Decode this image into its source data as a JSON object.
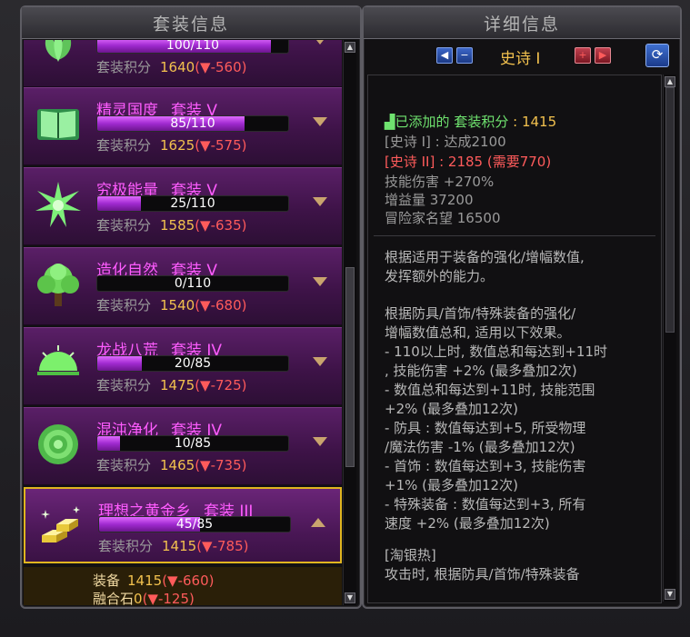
{
  "left_panel": {
    "title": "套装信息",
    "items": [
      {
        "name": "",
        "tier": "",
        "progress_text": "100/110",
        "progress": 0.909,
        "score_label": "套装积分",
        "score": "1640",
        "delta": "(▼-560)",
        "icon": "leaf-icon",
        "expanded": false
      },
      {
        "name": "精灵国度",
        "tier_prefix": "套装",
        "tier": "V",
        "progress_text": "85/110",
        "progress": 0.773,
        "score_label": "套装积分",
        "score": "1625",
        "delta": "(▼-575)",
        "icon": "book-icon",
        "expanded": false
      },
      {
        "name": "究极能量",
        "tier_prefix": "套装",
        "tier": "V",
        "progress_text": "25/110",
        "progress": 0.227,
        "score_label": "套装积分",
        "score": "1585",
        "delta": "(▼-635)",
        "icon": "starburst-icon",
        "expanded": false
      },
      {
        "name": "造化自然",
        "tier_prefix": "套装",
        "tier": "V",
        "progress_text": "0/110",
        "progress": 0.0,
        "score_label": "套装积分",
        "score": "1540",
        "delta": "(▼-680)",
        "icon": "tree-icon",
        "expanded": false
      },
      {
        "name": "龙战八荒",
        "tier_prefix": "套装",
        "tier": "IV",
        "progress_text": "20/85",
        "progress": 0.235,
        "score_label": "套装积分",
        "score": "1475",
        "delta": "(▼-725)",
        "icon": "sunrise-icon",
        "expanded": false
      },
      {
        "name": "混沌净化",
        "tier_prefix": "套装",
        "tier": "IV",
        "progress_text": "10/85",
        "progress": 0.118,
        "score_label": "套装积分",
        "score": "1465",
        "delta": "(▼-735)",
        "icon": "rose-icon",
        "expanded": false
      },
      {
        "name": "理想之黄金乡",
        "tier_prefix": "套装",
        "tier": "III",
        "progress_text": "45/85",
        "progress": 0.529,
        "score_label": "套装积分",
        "score": "1415",
        "delta": "(▼-785)",
        "icon": "gold-bars-icon",
        "expanded": true
      }
    ],
    "detail_strip": {
      "equip_label": "装备",
      "equip_val": "1415",
      "equip_delta": "(▼-660)",
      "fusion_label": "融合石",
      "fusion_val": "0",
      "fusion_delta": "(▼-125)"
    }
  },
  "right_panel": {
    "title": "详细信息",
    "tier_label": "史诗 I",
    "summary": {
      "added_label": "已添加的",
      "score_label": "套装积分",
      "score_value": ": 1415",
      "tier1": "[史诗 I] : 达成2100",
      "tier2": "[史诗 II] : 2185 (需要770)",
      "skill_damage": "技能伤害 +270%",
      "boost": "增益量 37200",
      "fame": "冒险家名望 16500"
    },
    "desc1": "根据适用于装备的强化/增幅数值,\n发挥额外的能力。",
    "desc2": "根据防具/首饰/特殊装备的强化/\n增幅数值总和, 适用以下效果。\n- 110以上时, 数值总和每达到+11时\n, 技能伤害 +2% (最多叠加2次)\n- 数值总和每达到+11时, 技能范围\n+2% (最多叠加12次)\n- 防具 : 数值每达到+5, 所受物理\n/魔法伤害 -1% (最多叠加12次)\n- 首饰 : 数值每达到+3, 技能伤害\n+1% (最多叠加12次)\n- 特殊装备 : 数值每达到+3, 所有\n速度 +2% (最多叠加12次)",
    "desc3": "[淘银热]\n攻击时, 根据防具/首饰/特殊装备"
  },
  "colors": {
    "accent_purple": "#ff5cff",
    "score_gold": "#f2c14e",
    "delta_red": "#ff5b5b",
    "green": "#6fe36f"
  }
}
